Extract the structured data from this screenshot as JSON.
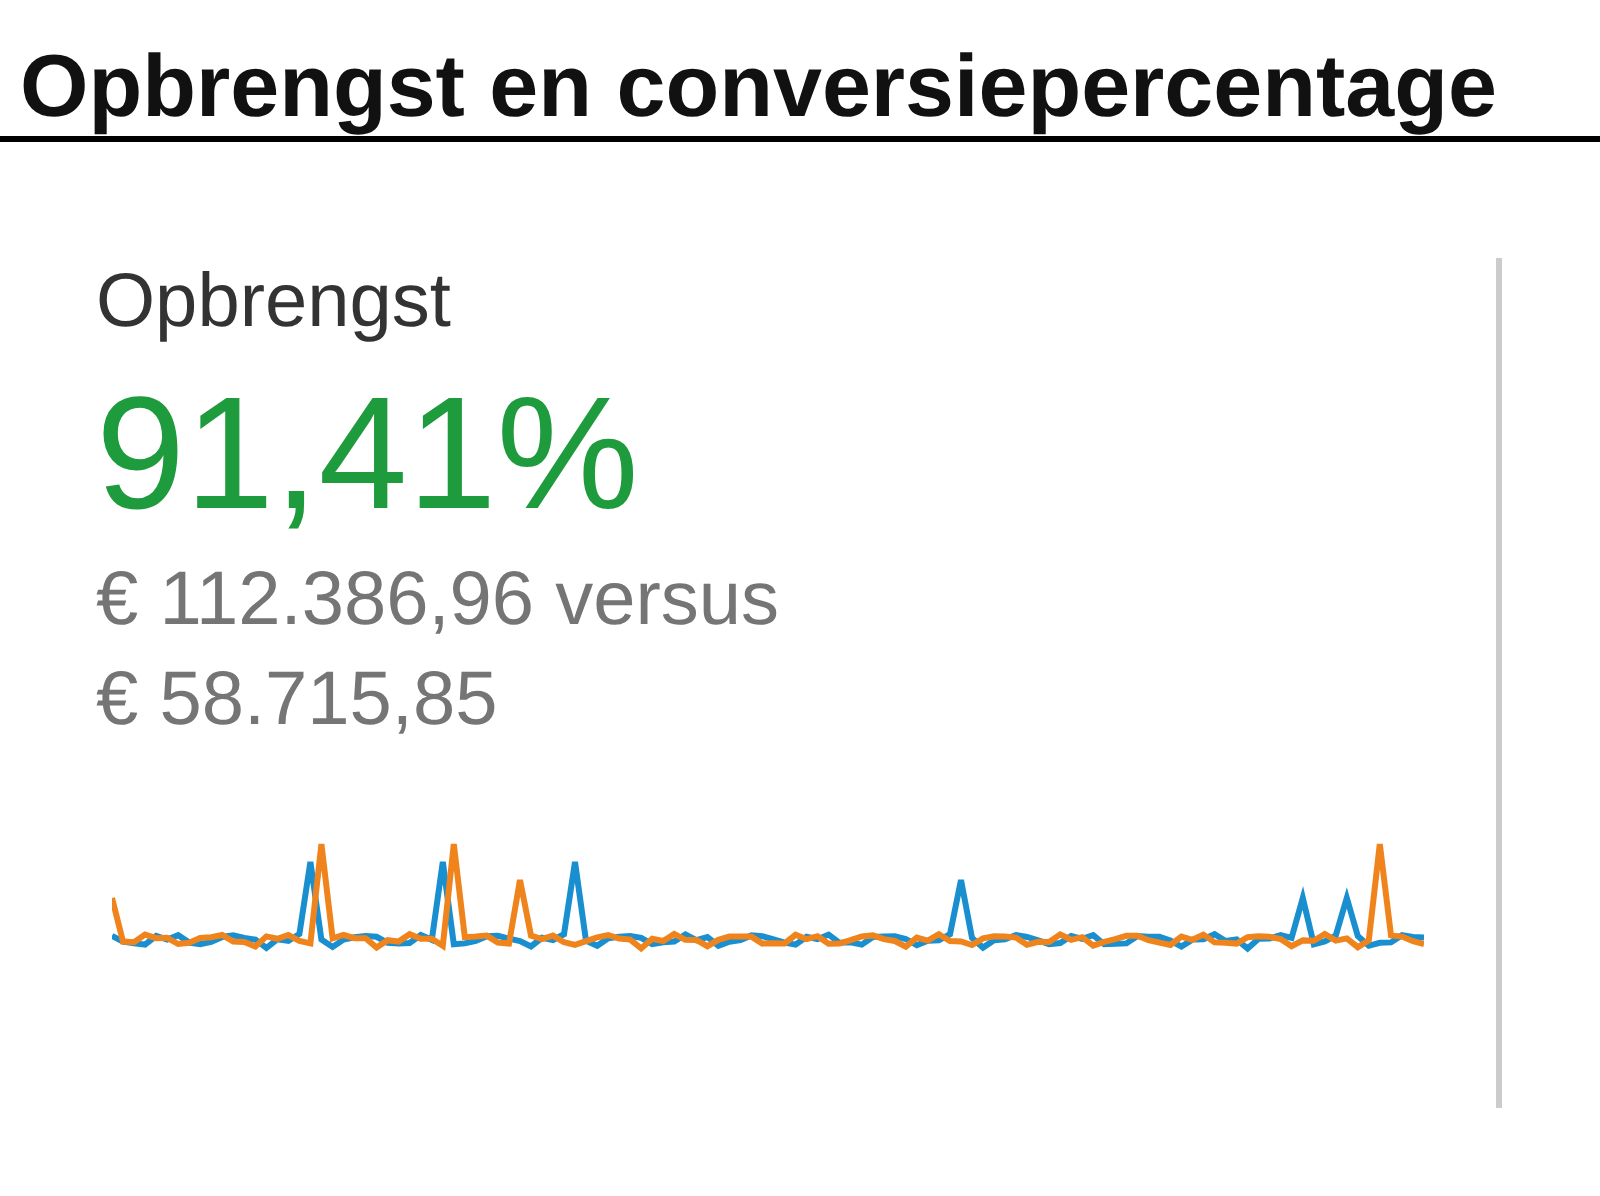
{
  "title": "Opbrengst en conversiepercentage",
  "metric": {
    "label": "Opbrengst",
    "value": "91,41%",
    "comparison": [
      "€ 112.386,96 versus",
      "€ 58.715,85"
    ]
  }
}
